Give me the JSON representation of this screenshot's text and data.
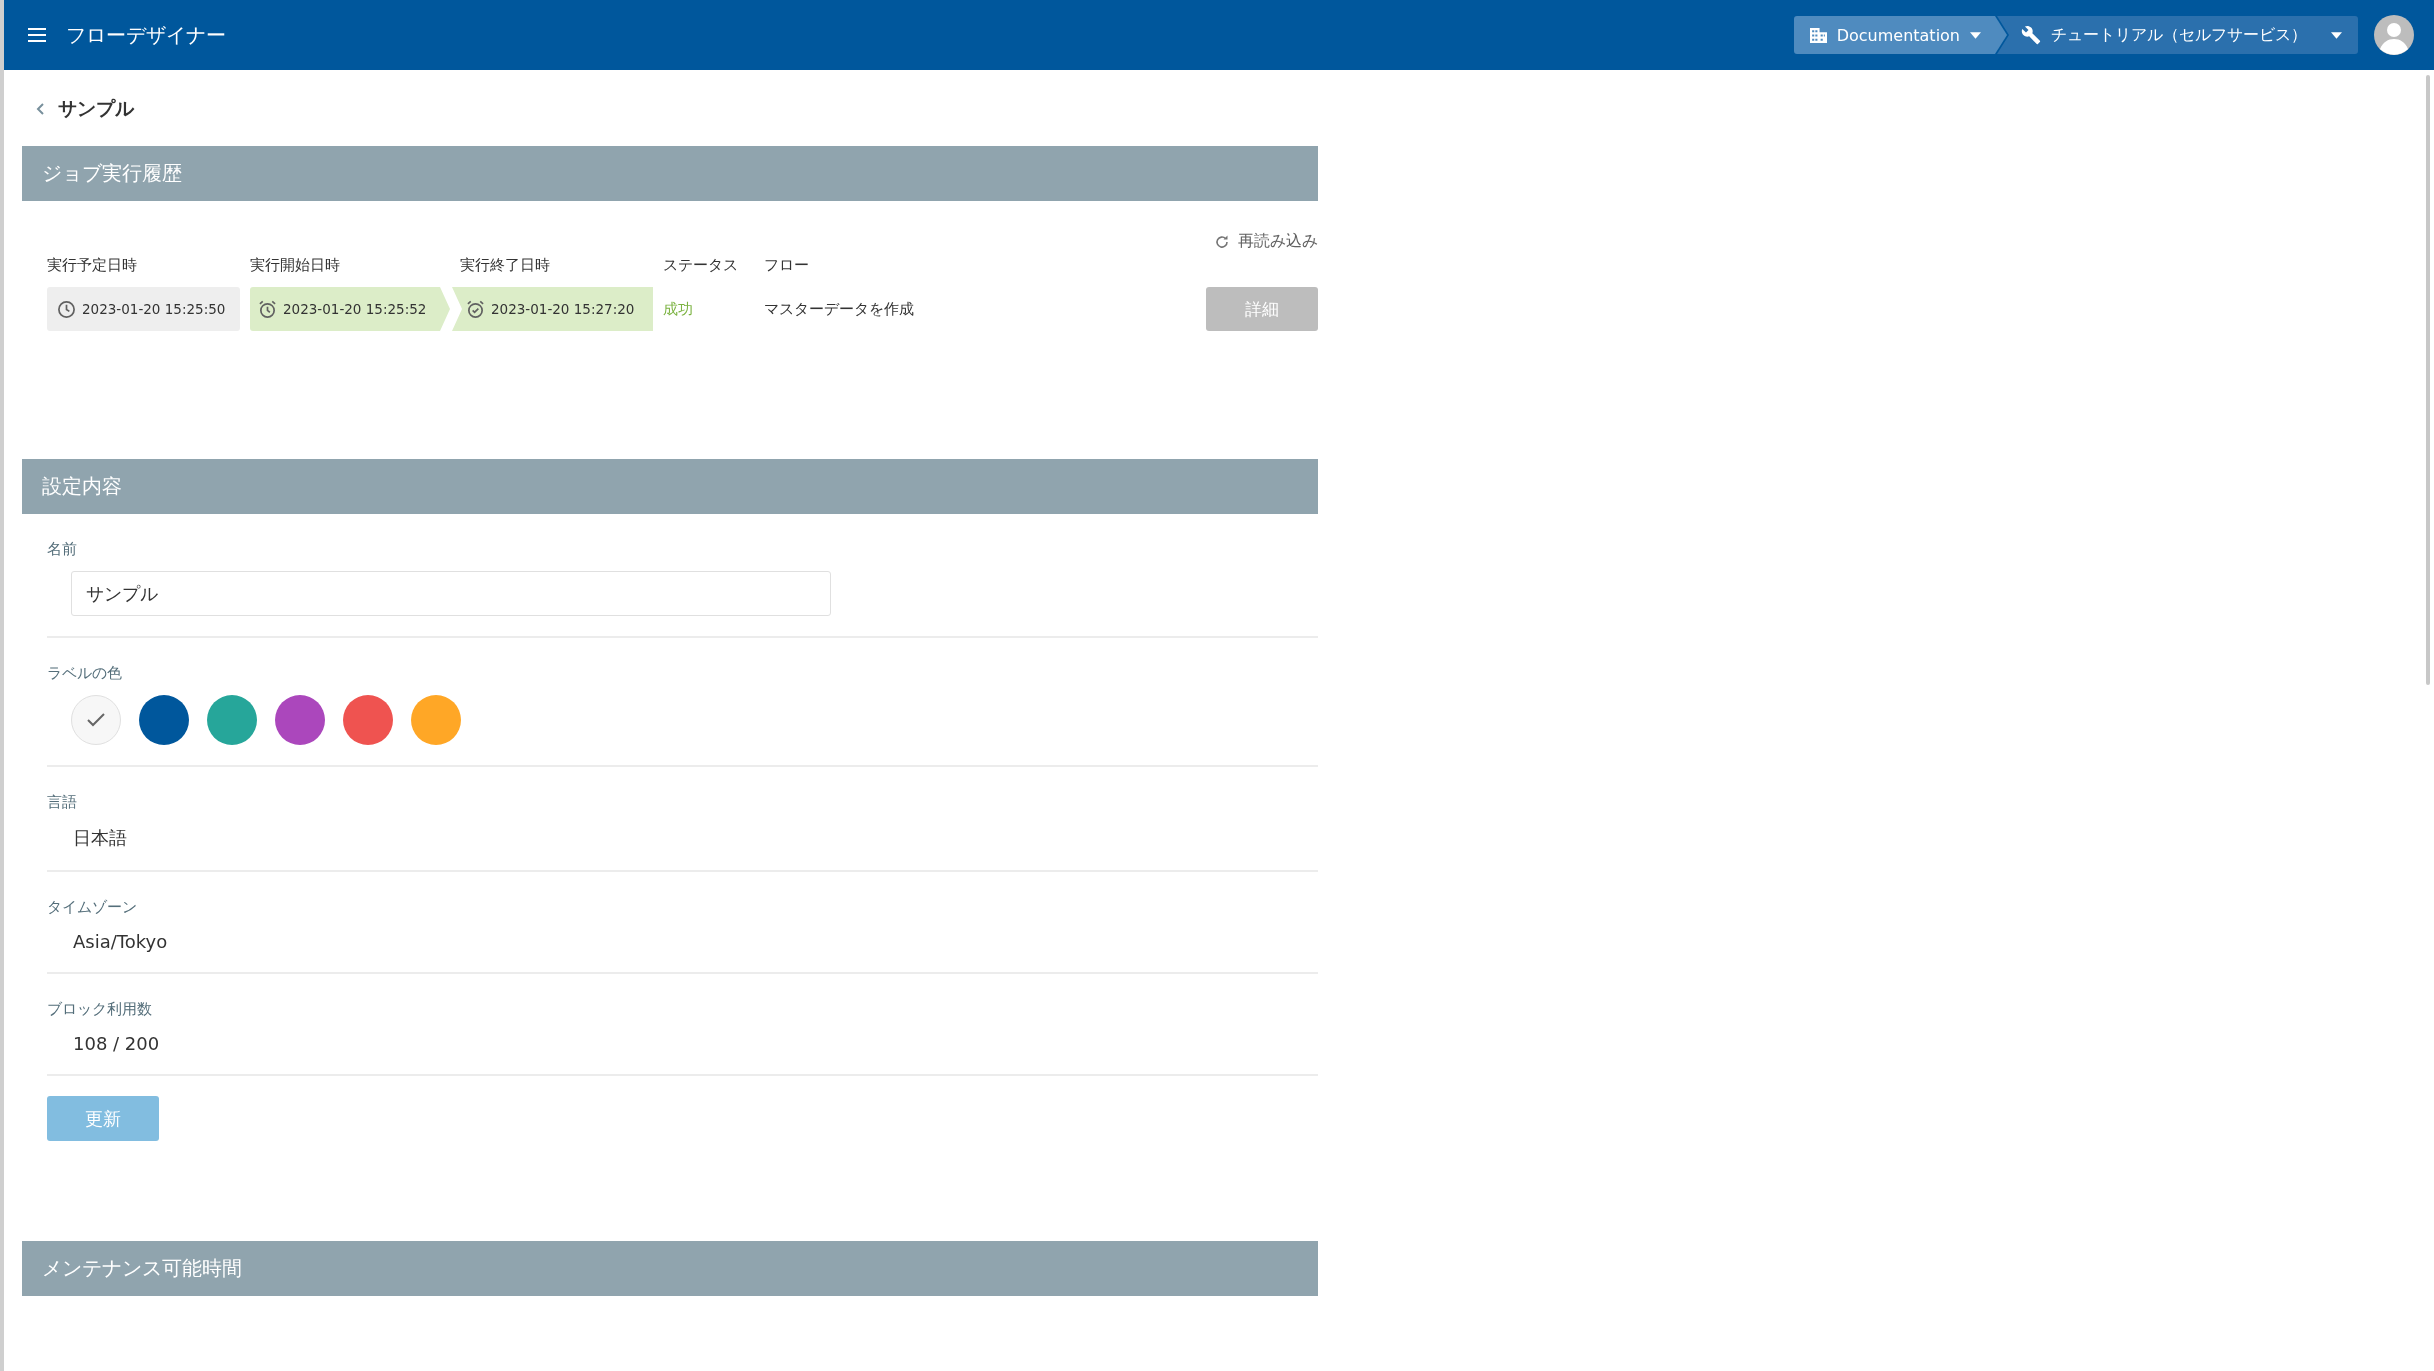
{
  "app_bar": {
    "title": "フローデザイナー",
    "workspace": "Documentation",
    "project": "チュートリアル（セルフサービス）"
  },
  "back_link": {
    "label": "サンプル"
  },
  "job_history": {
    "title": "ジョブ実行履歴",
    "reload": "再読み込み",
    "columns": [
      "実行予定日時",
      "実行開始日時",
      "実行終了日時",
      "ステータス",
      "フロー"
    ],
    "rows": [
      {
        "scheduled": "2023-01-20 15:25:50",
        "started": "2023-01-20 15:25:52",
        "finished": "2023-01-20 15:27:20",
        "status": "成功",
        "color": "#7cb342",
        "flow": "マスターデータを作成",
        "detail_button": {
          "label": "詳細",
          "disabled": true
        }
      }
    ]
  },
  "settings": {
    "title": "設定内容",
    "name": {
      "label": "名前",
      "value": "サンプル"
    },
    "label_color": {
      "label": "ラベルの色",
      "colors": [
        {
          "color": "#f7f7f7",
          "selected": true
        },
        {
          "color": "#00579c",
          "selected": false
        },
        {
          "color": "#26a69a",
          "selected": false
        },
        {
          "color": "#ab47bc",
          "selected": false
        },
        {
          "color": "#ef5350",
          "selected": false
        },
        {
          "color": "#ffa726",
          "selected": false
        }
      ]
    },
    "fields": [
      {
        "label": "言語",
        "value": "日本語"
      },
      {
        "label": "タイムゾーン",
        "value": "Asia/Tokyo"
      },
      {
        "label": "ブロック利用数",
        "value": "108 / 200"
      }
    ],
    "update_button": {
      "label": "更新",
      "disabled": true
    }
  },
  "maintenance": {
    "title": "メンテナンス可能時間"
  }
}
